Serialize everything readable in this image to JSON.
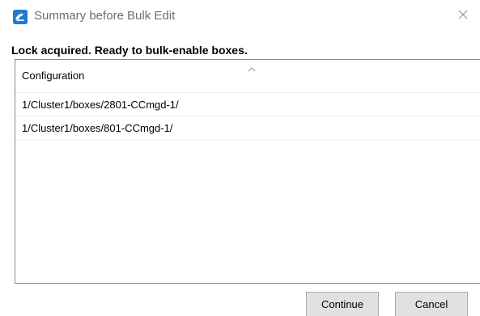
{
  "window": {
    "title": "Summary before Bulk Edit",
    "app_icon": "app-logo-icon",
    "close_icon": "close-icon"
  },
  "message": "Lock acquired. Ready to bulk-enable boxes.",
  "list": {
    "column_header": "Configuration",
    "sort_indicator": "sort-ascending-icon",
    "rows": [
      "1/Cluster1/boxes/2801-CCmgd-1/",
      "1/Cluster1/boxes/801-CCmgd-1/"
    ]
  },
  "buttons": {
    "continue_label": "Continue",
    "cancel_label": "Cancel"
  },
  "colors": {
    "accent": "#1f7ad2",
    "button_bg": "#e1e1e1",
    "border": "#828790"
  }
}
